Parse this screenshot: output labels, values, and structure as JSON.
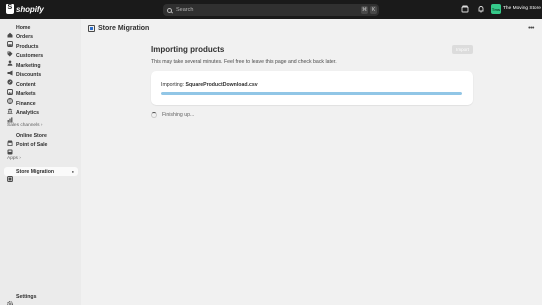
{
  "topbar": {
    "brand": "shopify",
    "search_placeholder": "Search",
    "shortcut_keys": [
      "⌘",
      "K"
    ],
    "store_initials": "Tms",
    "store_name": "The Moving Store"
  },
  "sidebar": {
    "items": [
      {
        "label": "Home",
        "icon": "home-icon"
      },
      {
        "label": "Orders",
        "icon": "orders-icon"
      },
      {
        "label": "Products",
        "icon": "tag-icon"
      },
      {
        "label": "Customers",
        "icon": "person-icon"
      },
      {
        "label": "Marketing",
        "icon": "megaphone-icon"
      },
      {
        "label": "Discounts",
        "icon": "discount-icon"
      },
      {
        "label": "Content",
        "icon": "content-icon"
      },
      {
        "label": "Markets",
        "icon": "globe-icon"
      },
      {
        "label": "Finance",
        "icon": "bank-icon"
      },
      {
        "label": "Analytics",
        "icon": "chart-icon"
      }
    ],
    "sales_channels_label": "Sales channels",
    "sales_channels": [
      {
        "label": "Online Store",
        "icon": "store-icon"
      },
      {
        "label": "Point of Sale",
        "icon": "pos-icon"
      }
    ],
    "apps_label": "Apps",
    "apps": [
      {
        "label": "Store Migration",
        "icon": "migration-icon",
        "active": true
      }
    ],
    "settings_label": "Settings"
  },
  "main": {
    "app_title": "Store Migration",
    "page_title": "Importing products",
    "import_button": "Import",
    "subtitle": "This may take several minutes. Feel free to leave this page and check back later.",
    "importing_prefix": "Importing:",
    "importing_file": "SquareProductDownload.csv",
    "progress": 1.0,
    "status_text": "Finishing up..."
  }
}
